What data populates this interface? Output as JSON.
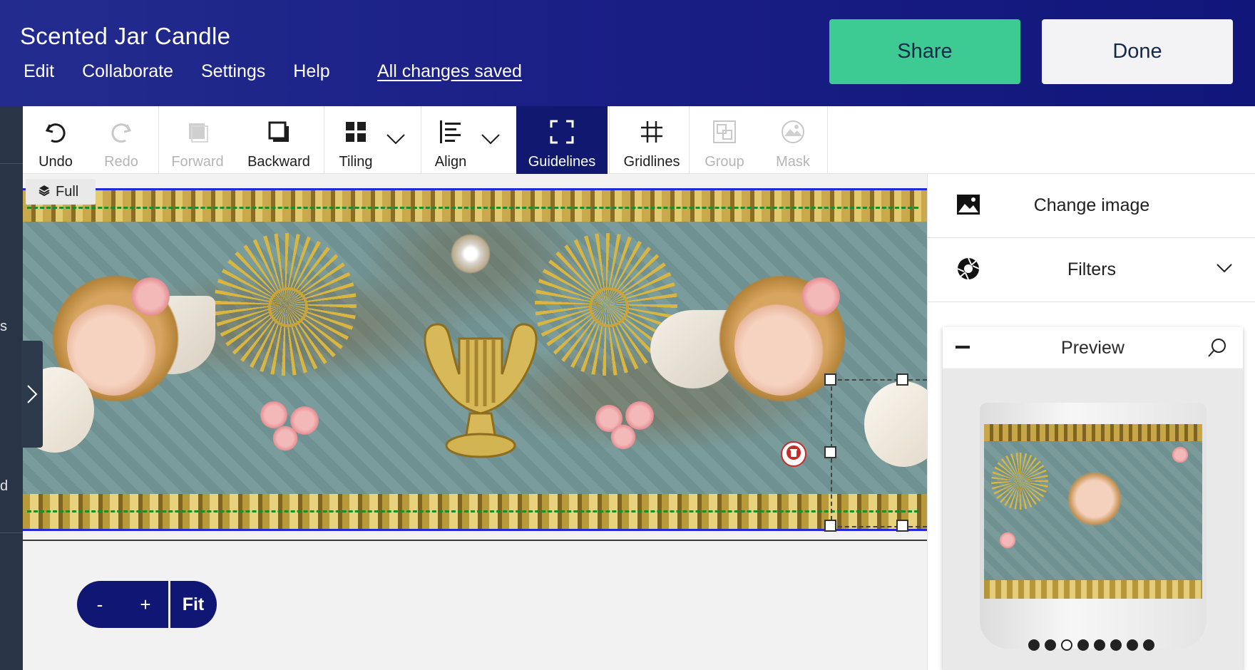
{
  "header": {
    "title": "Scented Jar Candle",
    "menu": [
      "Edit",
      "Collaborate",
      "Settings",
      "Help"
    ],
    "save_status": "All changes saved",
    "share_label": "Share",
    "done_label": "Done"
  },
  "toolbar": {
    "undo": "Undo",
    "redo": "Redo",
    "forward": "Forward",
    "backward": "Backward",
    "tiling": "Tiling",
    "align": "Align",
    "guidelines": "Guidelines",
    "gridlines": "Gridlines",
    "group": "Group",
    "mask": "Mask"
  },
  "canvas": {
    "layer_tag": "Full"
  },
  "zoom": {
    "minus": "-",
    "plus": "+",
    "fit": "Fit"
  },
  "panel": {
    "change_image": "Change image",
    "filters": "Filters",
    "preview_title": "Preview",
    "preview_dots": 8,
    "preview_active_dot": 3
  },
  "left_strip": {
    "fragments": [
      "s",
      "d"
    ]
  }
}
